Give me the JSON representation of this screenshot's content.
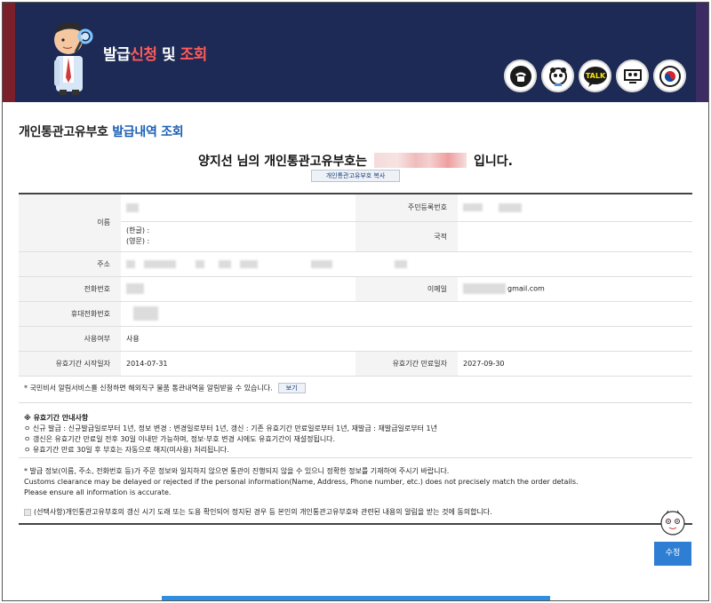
{
  "banner": {
    "title_part1": "발급",
    "title_part2": "신청",
    "title_part3": " 및 ",
    "title_part4": "조회",
    "quick_icons": [
      "phone-icon",
      "chatbot-icon",
      "kakao-talk-icon",
      "monitor-icon",
      "government-emblem-icon"
    ]
  },
  "page": {
    "title_prefix": "개인통관고유부호",
    "title_suffix": "발급내역 조회",
    "headline_prefix": "양지선 님의 개인통관고유부호는",
    "headline_suffix": "입니다.",
    "copy_button": "개인통관고유부호 복사"
  },
  "table": {
    "name_label": "이름",
    "name_korean": "(한글) :",
    "name_english": "(영문) :",
    "rrn_label": "주민등록번호",
    "nationality_label": "국적",
    "address_label": "주소",
    "phone_label": "전화번호",
    "email_label": "이메일",
    "email_value": "gmail.com",
    "mobile_label": "휴대전화번호",
    "usage_label": "사용여부",
    "usage_value": "사용",
    "valid_start_label": "유효기간 시작일자",
    "valid_start_value": "2014-07-31",
    "valid_end_label": "유효기간 만료일자",
    "valid_end_value": "2027-09-30"
  },
  "footnote": {
    "text": "* 국민비서 알림서비스를 신청하면 해외직구 물품 통관내역을 알림받을 수 있습니다.",
    "button": "보기"
  },
  "notice": {
    "heading": "※ 유효기간 안내사항",
    "lines": [
      "ㅇ 신규 발급 : 신규발급일로부터 1년, 정보 변경 : 변경일로부터 1년, 갱신 : 기존 유효기간 만료일로부터 1년, 재발급 : 재발급일로부터 1년",
      "ㅇ 갱신은 유효기간 만료일 전후 30일 이내만 가능하며, 정보·부호 변경 시에도 유효기간이 재설정됩니다.",
      "ㅇ 유효기간 만료 30일 후 부호는 자동으로 해지(미사용) 처리됩니다."
    ]
  },
  "warning": {
    "korean": "* 발급 정보(이름, 주소, 전화번호 등)가 주문 정보와 일치하지 않으면 통관이 진행되지 않을 수 있으니 정확한 정보를 기재하여 주시기 바랍니다.",
    "english1": "Customs clearance may be delayed or rejected if the personal information(Name, Address, Phone number, etc.) does not precisely match the order details.",
    "english2": "Please ensure all information is accurate."
  },
  "consent": {
    "text": "(선택사항)개인통관고유부호의 갱신 시기 도래 또는 도용 확인되어 정지된 경우 등 본인의 개인통관고유부호와 관련된 내용의 알림을 받는 것에 동의합니다."
  },
  "actions": {
    "edit_button": "수정"
  },
  "colors": {
    "banner_bg": "#1d2a55",
    "accent_blue": "#1a5fb4",
    "accent_red": "#ff5a5a",
    "button_blue": "#2e7fd4"
  }
}
